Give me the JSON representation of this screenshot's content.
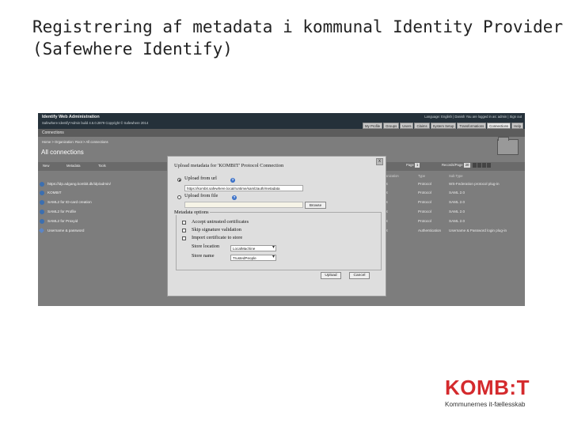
{
  "slide": {
    "title_line1": "Registrering af metadata i kommunal Identity Provider",
    "title_line2": "(Safewhere Identify)"
  },
  "app": {
    "title": "Identify Web Administration",
    "subtitle": "Safewhere Identify*Admin build 4.6.0.2879 Copyright © Safewhere 2014",
    "userbar": "Language: English | Danish    You are logged in as: admin | Sign out",
    "tabs": [
      "My Profile",
      "Groups",
      "Users",
      "Claims",
      "System Setup",
      "Transformations",
      "Connections",
      "Help"
    ],
    "active_tab": "Connections",
    "section": "Connections",
    "path": "Home > Organization: Root > All connections",
    "heading": "All connections"
  },
  "toolbar": {
    "new_label": "New",
    "metadata_label": "Metadata",
    "tools_label": "Tools",
    "page_label": "Page",
    "page_value": "1",
    "page_size_label": "Records/Page",
    "page_size_value": "20"
  },
  "table": {
    "columns": [
      "Organization",
      "Type",
      "Sub Type"
    ],
    "rows": [
      {
        "name": "https://idp.adgang.kombit.dk/idp/admin/",
        "org": "Root",
        "type": "Protocol",
        "subtype": "WS-Federation protocol plug-in",
        "icon": "globe-icon"
      },
      {
        "name": "KOMBIT",
        "org": "Root",
        "type": "Protocol",
        "subtype": "SAML 2.0",
        "icon": "globe-icon"
      },
      {
        "name": "SAML2 for ID-card creation",
        "org": "Root",
        "type": "Protocol",
        "subtype": "SAML 2.0",
        "icon": "globe-icon"
      },
      {
        "name": "SAML2 for Profile",
        "org": "Root",
        "type": "Protocol",
        "subtype": "SAML 2.0",
        "icon": "globe-icon"
      },
      {
        "name": "SAML2 for Proxyid",
        "org": "Root",
        "type": "Protocol",
        "subtype": "SAML 2.0",
        "icon": "globe-icon"
      },
      {
        "name": "Username & password",
        "org": "Root",
        "type": "Authentication",
        "subtype": "Username & Password login plug-in",
        "icon": "tool-icon"
      }
    ]
  },
  "dialog": {
    "title": "Upload metadata for 'KOMBIT' Protocol Connection",
    "close_label": "x",
    "upload_url_label": "Upload from url",
    "url_value": "https://kombit.safewhere.local/runtime/saml2auth/metadata",
    "upload_file_label": "Upload from file",
    "browse_label": "Browse",
    "options_legend": "Metadata options",
    "accept_untrusted_label": "Accept untrusted certificates",
    "skip_signature_label": "Skip signature validation",
    "import_cert_label": "Import certificate to store",
    "store_location_label": "Store location",
    "store_location_value": "LocalMachine",
    "store_name_label": "Store name",
    "store_name_value": "TrustedPeople",
    "upload_button": "Upload",
    "cancel_button": "Cancel",
    "help_glyph": "?"
  },
  "brand": {
    "logo_text": "KOMB:T",
    "tagline": "Kommunernes it-fællesskab",
    "logo_color": "#d42a2d"
  }
}
